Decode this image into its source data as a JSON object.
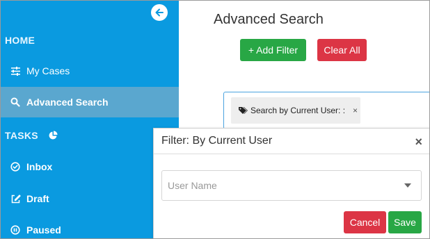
{
  "sidebar": {
    "collapse_icon": "arrow-left-icon",
    "sections": {
      "home": "HOME",
      "tasks": "TASKS",
      "tasks_icon": "pie-chart-icon"
    },
    "items": [
      {
        "label": "My Cases",
        "icon": "sliders-icon"
      },
      {
        "label": "Advanced Search",
        "icon": "search-icon",
        "active": true
      },
      {
        "label": "Inbox",
        "icon": "check-circle-icon"
      },
      {
        "label": "Draft",
        "icon": "edit-icon"
      },
      {
        "label": "Paused",
        "icon": "pause-circle-icon"
      }
    ],
    "colors": {
      "background": "#0a9ae0",
      "active": "#5aa7cf"
    }
  },
  "main": {
    "title": "Advanced Search",
    "add_filter_label": "+ Add Filter",
    "clear_all_label": "Clear All",
    "filter_chip": {
      "label": "Search by Current User: :",
      "close": "×",
      "icon": "tag-icon"
    }
  },
  "popover": {
    "title": "Filter: By Current User",
    "close": "×",
    "user_select": {
      "placeholder": "User Name"
    },
    "cancel_label": "Cancel",
    "save_label": "Save"
  },
  "colors": {
    "success": "#28a745",
    "danger": "#dc3545",
    "focus": "#4aa3df"
  }
}
